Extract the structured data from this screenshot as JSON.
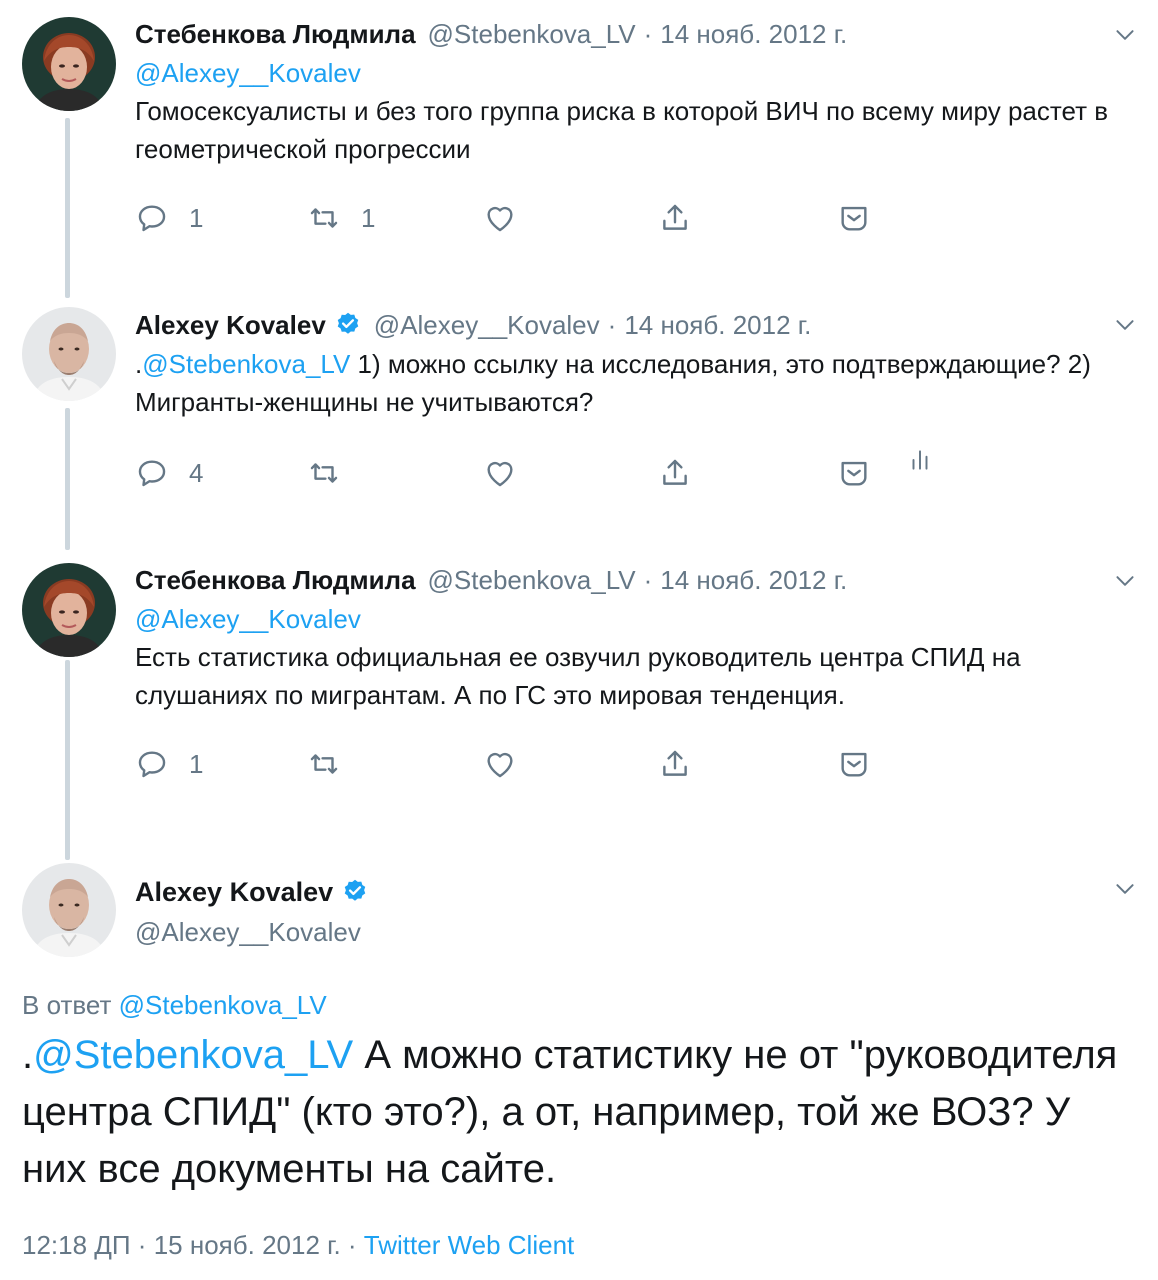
{
  "tweets": [
    {
      "name": "Стебенкова Людмила",
      "handle": "@Stebenkova_LV",
      "sep": "·",
      "date": "14 нояб. 2012 г.",
      "replying_to": "@Alexey__Kovalev",
      "text": "Гомосексуалисты и без того группа риска в которой ВИЧ по всему миру растет в геометрической прогрессии",
      "reply_count": "1",
      "retweet_count": "1",
      "like_count": ""
    },
    {
      "name": "Alexey Kovalev",
      "handle": "@Alexey__Kovalev",
      "sep": "·",
      "date": "14 нояб. 2012 г.",
      "text_prefix": ".",
      "text_mention": "@Stebenkova_LV",
      "text": " 1) можно ссылку на исследования, это подтверждающие? 2) Мигранты-женщины не учитываются?",
      "reply_count": "4",
      "retweet_count": "",
      "like_count": ""
    },
    {
      "name": "Стебенкова Людмила",
      "handle": "@Stebenkova_LV",
      "sep": "·",
      "date": "14 нояб. 2012 г.",
      "replying_to": "@Alexey__Kovalev",
      "text": "Есть статистика официальная ее озвучил руководитель центра СПИД на слушаниях по мигрантам. А по ГС это мировая тенденция.",
      "reply_count": "1",
      "retweet_count": "",
      "like_count": ""
    }
  ],
  "main": {
    "name": "Alexey Kovalev",
    "handle": "@Alexey__Kovalev",
    "replying_label": "В ответ ",
    "replying_to": "@Stebenkova_LV",
    "text_prefix": ".",
    "text_mention": "@Stebenkova_LV",
    "text": " А можно статистику не от \"руководителя центра СПИД\" (кто это?), а от, например, той же ВОЗ? У них все документы на сайте.",
    "time": "12:18 ДП · 15 нояб. 2012 г. · ",
    "source": "Twitter Web Client"
  },
  "icons": {
    "reply": "reply-icon",
    "retweet": "retweet-icon",
    "like": "heart-icon",
    "share": "share-icon",
    "dm": "bookmark-icon",
    "analytics": "analytics-icon",
    "caret": "chevron-down-icon",
    "verified": "verified-badge-icon"
  },
  "colors": {
    "accent": "#1da1f2",
    "secondary_text": "#657786",
    "thread_line": "#ccd6dd",
    "text": "#14171a"
  }
}
